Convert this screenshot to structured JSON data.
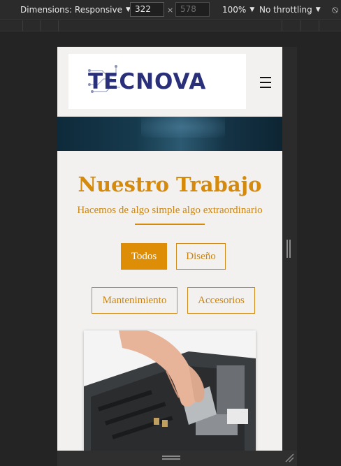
{
  "devtools": {
    "dimensions_label": "Dimensions: Responsive",
    "width_value": "322",
    "height_value": "578",
    "times": "×",
    "zoom": "100%",
    "throttle": "No throttling"
  },
  "site": {
    "logo_text": "TECNOVA",
    "section_title": "Nuestro Trabajo",
    "section_subtitle": "Hacemos de algo simple algo extraordinario",
    "filters": {
      "todos": "Todos",
      "diseno": "Diseño",
      "mantenimiento": "Mantenimiento",
      "accesorios": "Accesorios"
    },
    "active_filter": "Todos"
  },
  "colors": {
    "accent": "#de8e06",
    "logo": "#2a2f7a",
    "page_bg": "#f2f1f0",
    "devtools_bg": "#242424"
  },
  "icons": [
    "dropdown-caret-icon",
    "rotate-icon",
    "hamburger-menu-icon",
    "resize-handle-icon",
    "resize-corner-icon"
  ]
}
